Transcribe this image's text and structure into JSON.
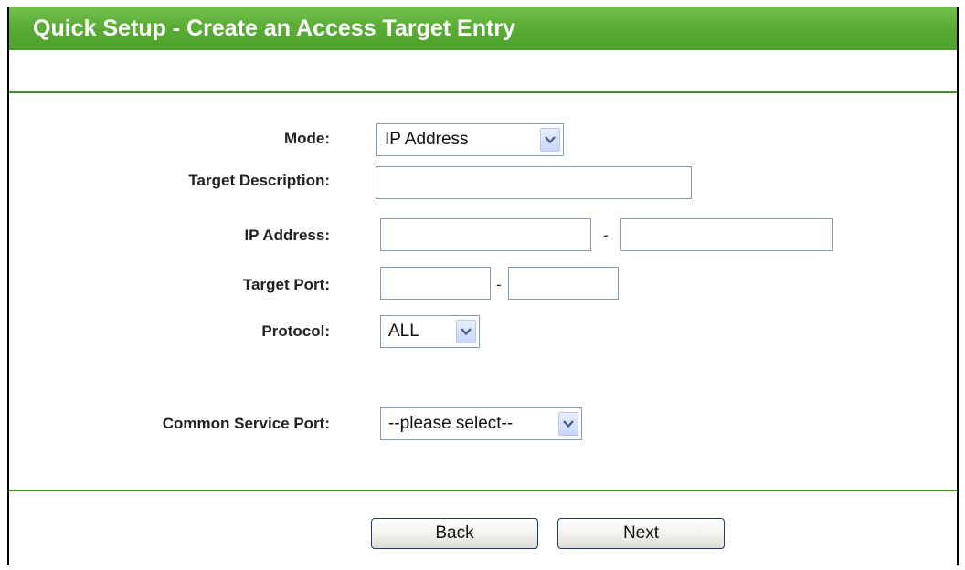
{
  "header": {
    "title": "Quick Setup - Create an Access Target Entry"
  },
  "form": {
    "mode": {
      "label": "Mode:",
      "value": "IP Address"
    },
    "target_description": {
      "label": "Target Description:",
      "value": ""
    },
    "ip_address": {
      "label": "IP Address:",
      "start": "",
      "end": "",
      "separator": "-"
    },
    "target_port": {
      "label": "Target Port:",
      "start": "",
      "end": "",
      "separator": "-"
    },
    "protocol": {
      "label": "Protocol:",
      "value": "ALL"
    },
    "common_service_port": {
      "label": "Common Service Port:",
      "value": "--please select--"
    }
  },
  "buttons": {
    "back": "Back",
    "next": "Next"
  },
  "icons": {
    "dropdown": "chevron-down-icon"
  },
  "colors": {
    "header_green": "#5aad36",
    "divider_green": "#3f8f2a",
    "field_border": "#7f9db9"
  }
}
